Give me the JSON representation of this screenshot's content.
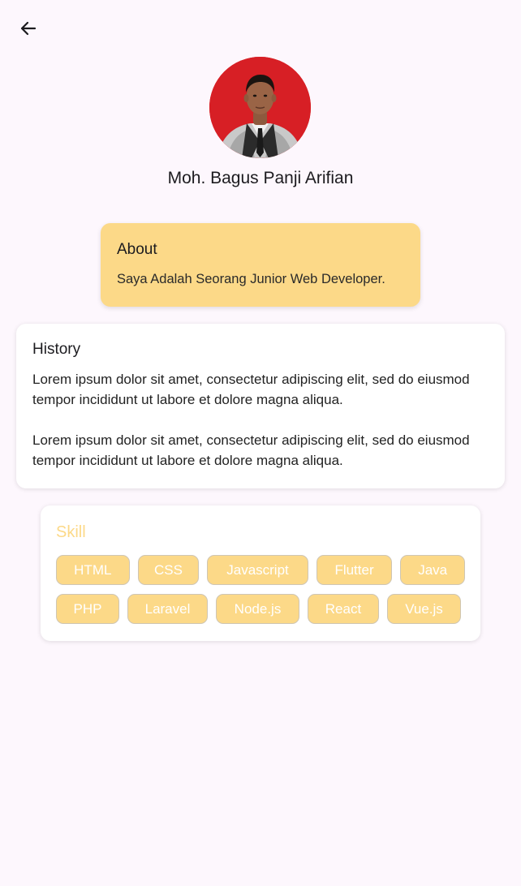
{
  "header": {
    "back_icon": "arrow-left-icon"
  },
  "profile": {
    "name": "Moh. Bagus Panji Arifian",
    "avatar_alt": "profile photo"
  },
  "about": {
    "title": "About",
    "text": "Saya Adalah Seorang Junior Web Developer."
  },
  "history": {
    "title": "History",
    "paragraphs": [
      "Lorem ipsum dolor sit amet, consectetur adipiscing elit, sed do eiusmod tempor incididunt ut labore et dolore magna aliqua.",
      "Lorem ipsum dolor sit amet, consectetur adipiscing elit, sed do eiusmod tempor incididunt ut labore et dolore magna aliqua."
    ]
  },
  "skill": {
    "title": "Skill",
    "items": [
      "HTML",
      "CSS",
      "Javascript",
      "Flutter",
      "Java",
      "PHP",
      "Laravel",
      "Node.js",
      "React",
      "Vue.js"
    ]
  },
  "colors": {
    "accent": "#fcd988",
    "background": "#fdf7fd",
    "card": "#ffffff",
    "avatar_bg": "#d71f25"
  }
}
